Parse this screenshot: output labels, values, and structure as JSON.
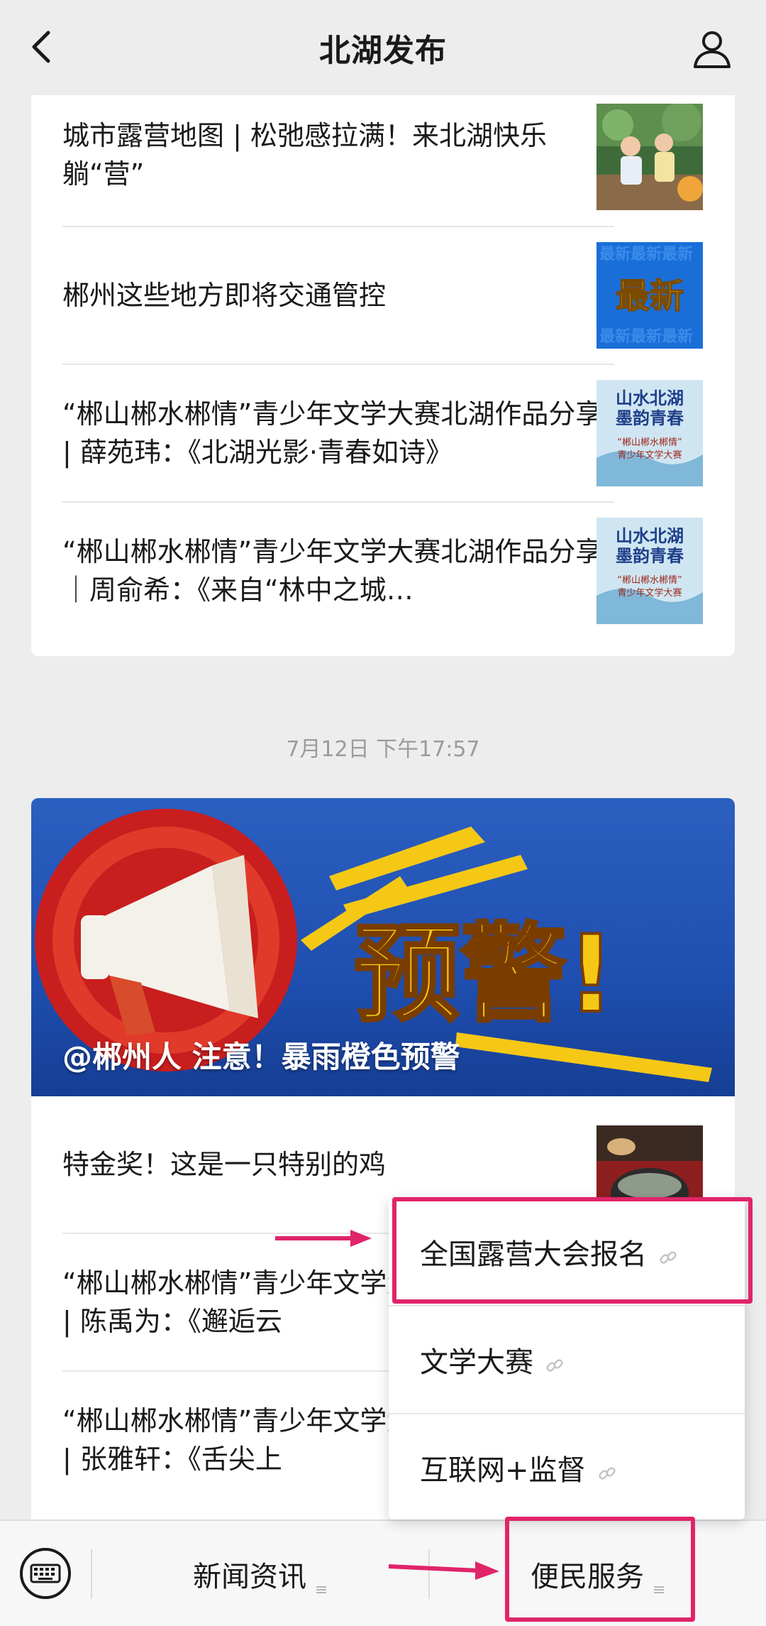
{
  "header": {
    "title": "北湖发布"
  },
  "articles_top": [
    {
      "title": "城市露营地图 | 松弛感拉满！来北湖快乐躺“营”",
      "thumb": "camping-kids-photo"
    },
    {
      "title": "郴州这些地方即将交通管控",
      "thumb_text": "最新"
    },
    {
      "title": "“郴山郴水郴情”青少年文学大赛北湖作品分享 | 薛苑玮：《北湖光影·青春如诗》",
      "thumb_lines": [
        "山水北湖",
        "墨韵青春",
        "“郴山郴水郴情”",
        "青少年文学大赛"
      ]
    },
    {
      "title": "“郴山郴水郴情”青少年文学大赛北湖作品分享｜周俞希：《来自“林中之城…",
      "thumb_lines": [
        "山水北湖",
        "墨韵青春",
        "“郴山郴水郴情”",
        "青少年文学大赛"
      ]
    }
  ],
  "timestamp": "7月12日 下午17:57",
  "banner": {
    "big_text": "预警!",
    "caption": "@郴州人 注意！暴雨橙色预警"
  },
  "articles_bottom": [
    {
      "title": "特金奖！这是一只特别的鸡"
    },
    {
      "title": "“郴山郴水郴情”青少年文学大赛北湖作品分享 | 陈禹为：《邂逅云"
    },
    {
      "title": "“郴山郴水郴情”青少年文学大赛北湖作品分享 | 张雅轩：《舌尖上"
    }
  ],
  "popup_menu": {
    "items": [
      {
        "label": "全国露营大会报名"
      },
      {
        "label": "文学大赛"
      },
      {
        "label": "互联网+监督"
      }
    ]
  },
  "bottom_menu": {
    "items": [
      {
        "label": "新闻资讯"
      },
      {
        "label": "便民服务"
      }
    ]
  },
  "colors": {
    "highlight": "#e0246a",
    "banner_blue": "#2459bd",
    "warning_yellow": "#f5c816"
  }
}
